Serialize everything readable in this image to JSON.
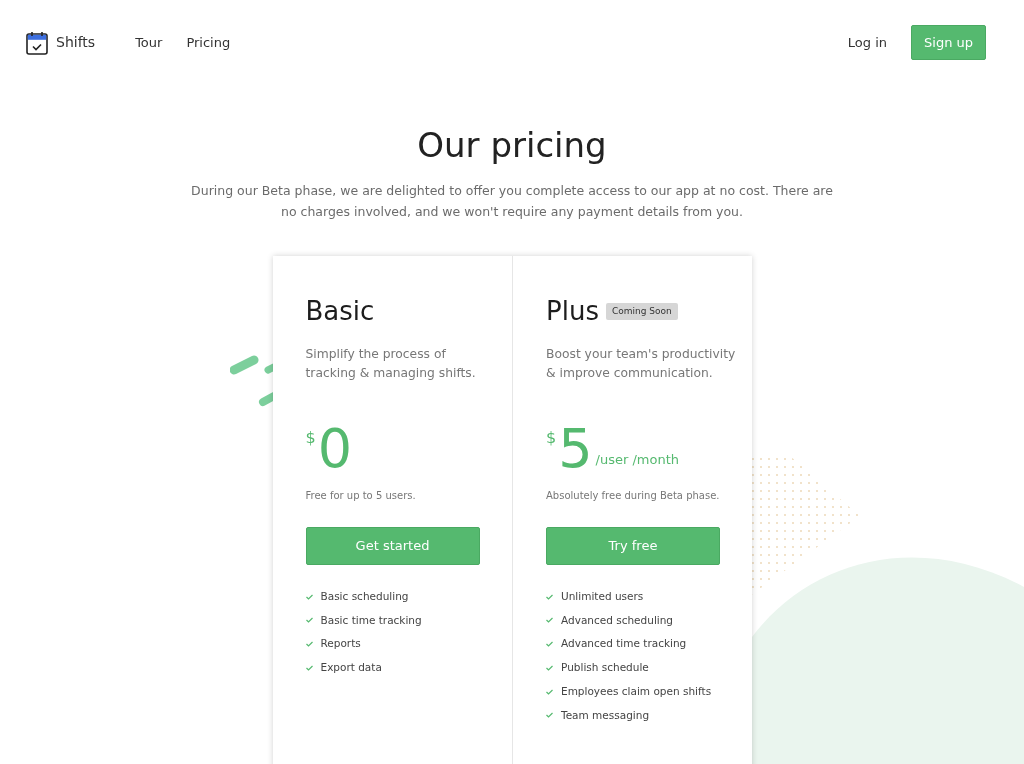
{
  "brand": {
    "name": "Shifts"
  },
  "nav_links": [
    {
      "label": "Tour"
    },
    {
      "label": "Pricing"
    }
  ],
  "auth": {
    "login": "Log in",
    "signup": "Sign up"
  },
  "hero": {
    "title": "Our pricing",
    "subtitle": "During our Beta phase, we are delighted to offer you complete access to our app at no cost. There are no charges involved, and we won't require any payment details from you."
  },
  "plans": [
    {
      "name": "Basic",
      "description": "Simplify the process of tracking & managing shifts.",
      "currency": "$",
      "price": "0",
      "note": "Free for up to 5 users.",
      "button": "Get started",
      "features": [
        "Basic scheduling",
        "Basic time tracking",
        "Reports",
        "Export data"
      ]
    },
    {
      "name": "Plus",
      "badge": "Coming Soon",
      "description": "Boost your team's productivity & improve communication.",
      "currency": "$",
      "price": "5",
      "unit": "/user /month",
      "note": "Absolutely free during Beta phase.",
      "button": "Try free",
      "features": [
        "Unlimited users",
        "Advanced scheduling",
        "Advanced time tracking",
        "Publish schedule",
        "Employees claim open shifts",
        "Team messaging"
      ]
    }
  ]
}
